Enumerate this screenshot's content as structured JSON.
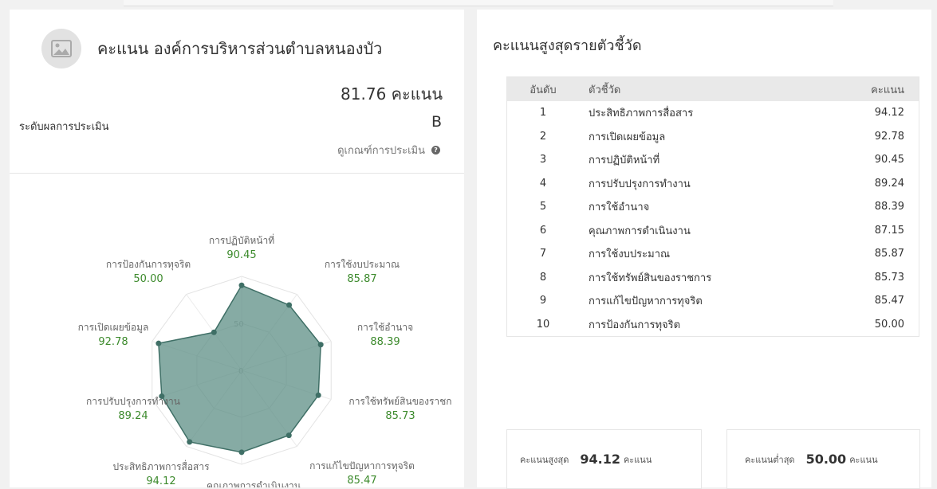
{
  "header": {
    "title": "คะแนน องค์การบริหารส่วนตำบลหนองบัว",
    "score_text": "81.76 คะแนน",
    "level_label": "ระดับผลการประเมิน",
    "level_value": "B",
    "criteria_link": "ดูเกณฑ์การประเมิน"
  },
  "radar": {
    "ticks": [
      "50",
      "0"
    ],
    "axes": [
      {
        "label": "การปฏิบัติหน้าที่",
        "value": "90.45",
        "v": 90.45
      },
      {
        "label": "การใช้งบประมาณ",
        "value": "85.87",
        "v": 85.87
      },
      {
        "label": "การใช้อำนาจ",
        "value": "88.39",
        "v": 88.39
      },
      {
        "label": "การใช้ทรัพย์สินของราชก",
        "value": "85.73",
        "v": 85.73
      },
      {
        "label": "การแก้ไขปัญหาการทุจริต",
        "value": "85.47",
        "v": 85.47
      },
      {
        "label": "คุณภาพการดำเนินงาน",
        "value": "",
        "v": 87.15
      },
      {
        "label": "ประสิทธิภาพการสื่อสาร",
        "value": "94.12",
        "v": 94.12
      },
      {
        "label": "การปรับปรุงการทำงาน",
        "value": "89.24",
        "v": 89.24
      },
      {
        "label": "การเปิดเผยข้อมูล",
        "value": "92.78",
        "v": 92.78
      },
      {
        "label": "การป้องกันการทุจริต",
        "value": "50.00",
        "v": 50.0
      }
    ],
    "fill_color": "#5e8f85",
    "max": 100
  },
  "ranking": {
    "title": "คะแนนสูงสุดรายตัวชี้วัด",
    "columns": [
      "อันดับ",
      "ตัวชี้วัด",
      "คะแนน"
    ],
    "rows": [
      {
        "rank": "1",
        "name": "ประสิทธิภาพการสื่อสาร",
        "score": "94.12"
      },
      {
        "rank": "2",
        "name": "การเปิดเผยข้อมูล",
        "score": "92.78"
      },
      {
        "rank": "3",
        "name": "การปฏิบัติหน้าที่",
        "score": "90.45"
      },
      {
        "rank": "4",
        "name": "การปรับปรุงการทำงาน",
        "score": "89.24"
      },
      {
        "rank": "5",
        "name": "การใช้อำนาจ",
        "score": "88.39"
      },
      {
        "rank": "6",
        "name": "คุณภาพการดำเนินงาน",
        "score": "87.15"
      },
      {
        "rank": "7",
        "name": "การใช้งบประมาณ",
        "score": "85.87"
      },
      {
        "rank": "8",
        "name": "การใช้ทรัพย์สินของราชการ",
        "score": "85.73"
      },
      {
        "rank": "9",
        "name": "การแก้ไขปัญหาการทุจริต",
        "score": "85.47"
      },
      {
        "rank": "10",
        "name": "การป้องกันการทุจริต",
        "score": "50.00"
      }
    ]
  },
  "summary": {
    "max_label": "คะแนนสูงสุด",
    "max_value": "94.12",
    "max_unit": "คะแนน",
    "min_label": "คะแนนต่ำสุด",
    "min_value": "50.00",
    "min_unit": "คะแนน"
  }
}
